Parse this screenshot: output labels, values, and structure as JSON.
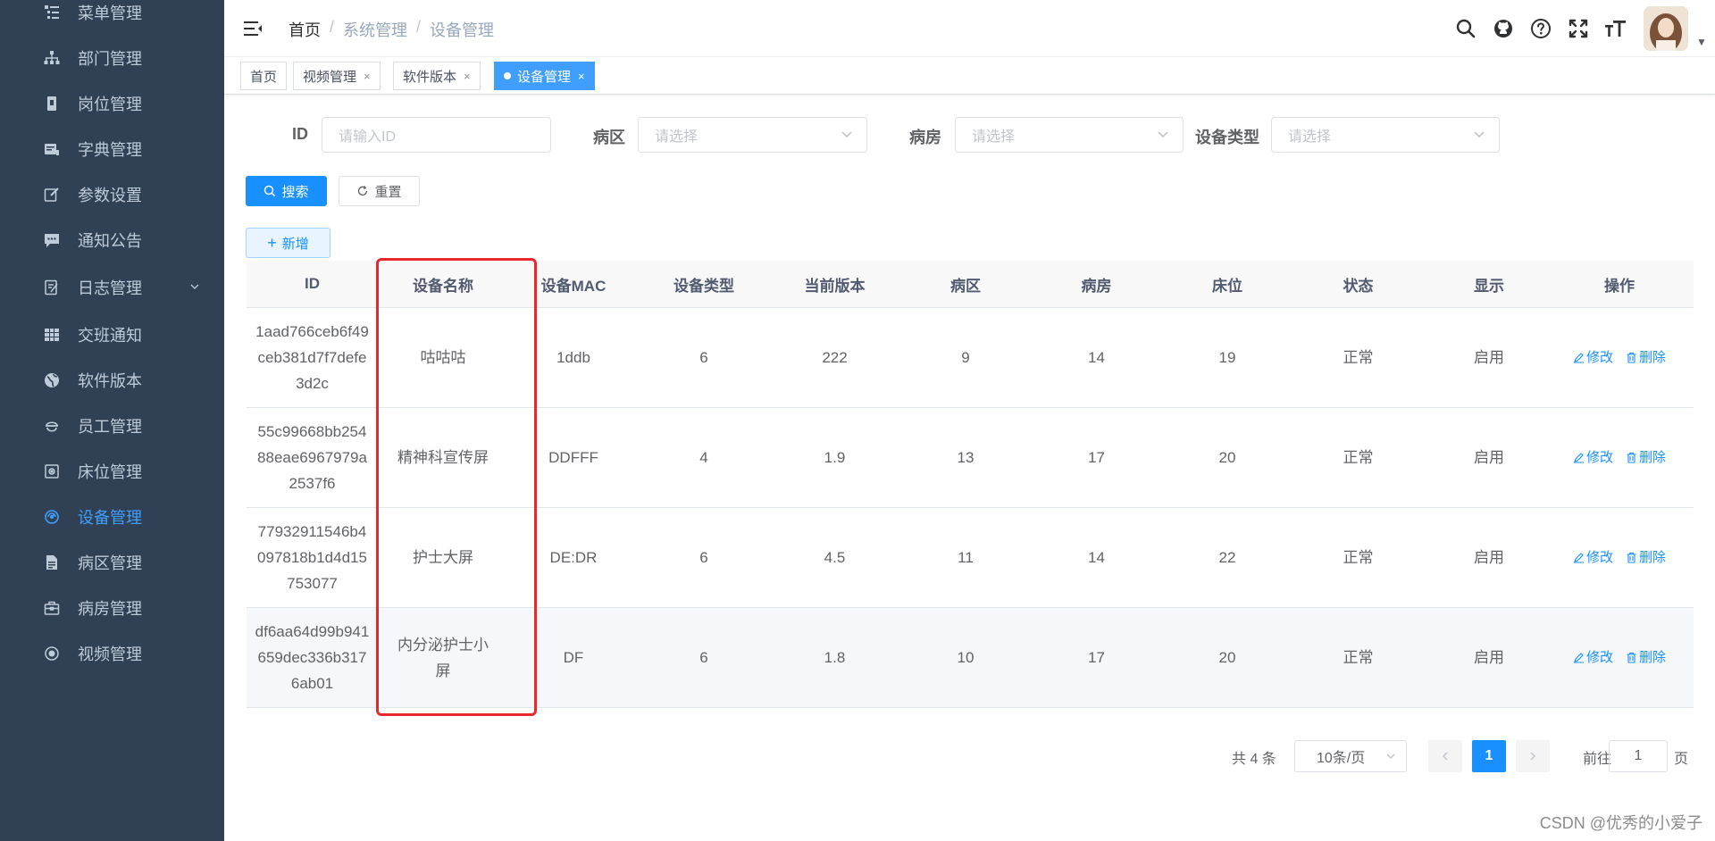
{
  "sidebar": {
    "items": [
      {
        "label": "菜单管理",
        "icon": "tree-table-icon",
        "active": false
      },
      {
        "label": "部门管理",
        "icon": "org-tree-icon",
        "active": false
      },
      {
        "label": "岗位管理",
        "icon": "post-icon",
        "active": false
      },
      {
        "label": "字典管理",
        "icon": "dict-icon",
        "active": false
      },
      {
        "label": "参数设置",
        "icon": "edit-icon",
        "active": false
      },
      {
        "label": "通知公告",
        "icon": "message-icon",
        "active": false
      },
      {
        "label": "日志管理",
        "icon": "log-icon",
        "active": false,
        "has_children": true
      },
      {
        "label": "交班通知",
        "icon": "grid-icon",
        "active": false
      },
      {
        "label": "软件版本",
        "icon": "globe-icon",
        "active": false
      },
      {
        "label": "员工管理",
        "icon": "staff-icon",
        "active": false
      },
      {
        "label": "床位管理",
        "icon": "bed-icon",
        "active": false
      },
      {
        "label": "设备管理",
        "icon": "device-icon",
        "active": true
      },
      {
        "label": "病区管理",
        "icon": "document-icon",
        "active": false
      },
      {
        "label": "病房管理",
        "icon": "briefcase-icon",
        "active": false
      },
      {
        "label": "视频管理",
        "icon": "radio-icon",
        "active": false
      }
    ]
  },
  "breadcrumb": {
    "home": "首页",
    "level1": "系统管理",
    "level2": "设备管理",
    "separator": "/"
  },
  "tags": [
    {
      "label": "首页",
      "closable": false,
      "active": false
    },
    {
      "label": "视频管理",
      "closable": true,
      "active": false
    },
    {
      "label": "软件版本",
      "closable": true,
      "active": false
    },
    {
      "label": "设备管理",
      "closable": true,
      "active": true
    }
  ],
  "search_form": {
    "id_label": "ID",
    "id_placeholder": "请输入ID",
    "ward_label": "病区",
    "ward_placeholder": "请选择",
    "room_label": "病房",
    "room_placeholder": "请选择",
    "type_label": "设备类型",
    "type_placeholder": "请选择",
    "search_button": "搜索",
    "reset_button": "重置"
  },
  "toolbar": {
    "add_button": "新增"
  },
  "table": {
    "columns": [
      "ID",
      "设备名称",
      "设备MAC",
      "设备类型",
      "当前版本",
      "病区",
      "病房",
      "床位",
      "状态",
      "显示",
      "操作"
    ],
    "rows": [
      {
        "id": "1aad766ceb6f49ceb381d7f7defe3d2c",
        "id_lines": [
          "1aad766ceb6f49",
          "ceb381d7f7defe",
          "3d2c"
        ],
        "name_lines": [
          "咕咕咕"
        ],
        "mac": "1ddb",
        "type": "6",
        "version": "222",
        "ward": "9",
        "room": "14",
        "bed": "19",
        "status": "正常",
        "display": "启用"
      },
      {
        "id": "55c99668bb25488eae6967979a2537f6",
        "id_lines": [
          "55c99668bb254",
          "88eae6967979a",
          "2537f6"
        ],
        "name_lines": [
          "精神科宣传屏"
        ],
        "mac": "DDFFF",
        "type": "4",
        "version": "1.9",
        "ward": "13",
        "room": "17",
        "bed": "20",
        "status": "正常",
        "display": "启用"
      },
      {
        "id": "77932911546b4097818b1d4d15753077",
        "id_lines": [
          "77932911546b4",
          "097818b1d4d15",
          "753077"
        ],
        "name_lines": [
          "护士大屏"
        ],
        "mac": "DE:DR",
        "type": "6",
        "version": "4.5",
        "ward": "11",
        "room": "14",
        "bed": "22",
        "status": "正常",
        "display": "启用"
      },
      {
        "id": "df6aa64d99b941659dec336b3176ab01",
        "id_lines": [
          "df6aa64d99b941",
          "659dec336b317",
          "6ab01"
        ],
        "name_lines": [
          "内分泌护士小",
          "屏"
        ],
        "mac": "DF",
        "type": "6",
        "version": "1.8",
        "ward": "10",
        "room": "17",
        "bed": "20",
        "status": "正常",
        "display": "启用"
      }
    ],
    "edit_label": "修改",
    "delete_label": "删除"
  },
  "pagination": {
    "total_text": "共 4 条",
    "page_size": "10条/页",
    "current_page": "1",
    "goto_prefix": "前往",
    "goto_value": "1",
    "goto_suffix": "页"
  },
  "watermark": "CSDN @优秀的小爱子",
  "colors": {
    "sidebar_bg": "#304156",
    "sidebar_text": "#bfcbd9",
    "primary": "#1890ff",
    "highlight_box": "#e8282b"
  }
}
